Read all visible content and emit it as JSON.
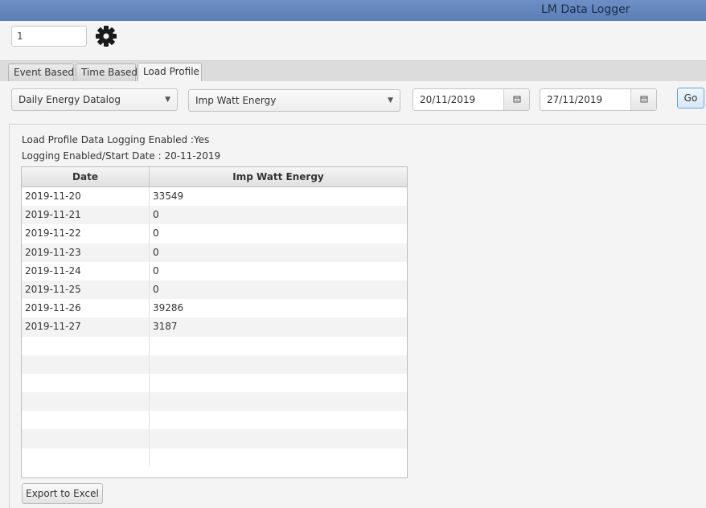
{
  "window": {
    "title": "LM Data Logger"
  },
  "topbar": {
    "device_id": "1"
  },
  "tabs": [
    {
      "label": "Event Based"
    },
    {
      "label": "Time Based"
    },
    {
      "label": "Load Profile"
    }
  ],
  "toolbar": {
    "profile_type": "Daily Energy Datalog",
    "parameter": "Imp Watt Energy",
    "from_date": "20/11/2019",
    "to_date": "27/11/2019",
    "go_label": "Go"
  },
  "info": {
    "logging_enabled": "Load Profile Data Logging Enabled :Yes",
    "start_date": "Logging Enabled/Start Date : 20-11-2019"
  },
  "table": {
    "columns": [
      "Date",
      "Imp Watt Energy"
    ],
    "rows": [
      [
        "2019-11-20",
        "33549"
      ],
      [
        "2019-11-21",
        "0"
      ],
      [
        "2019-11-22",
        "0"
      ],
      [
        "2019-11-23",
        "0"
      ],
      [
        "2019-11-24",
        "0"
      ],
      [
        "2019-11-25",
        "0"
      ],
      [
        "2019-11-26",
        "39286"
      ],
      [
        "2019-11-27",
        "3187"
      ]
    ]
  },
  "footer": {
    "export_label": "Export to Excel"
  }
}
